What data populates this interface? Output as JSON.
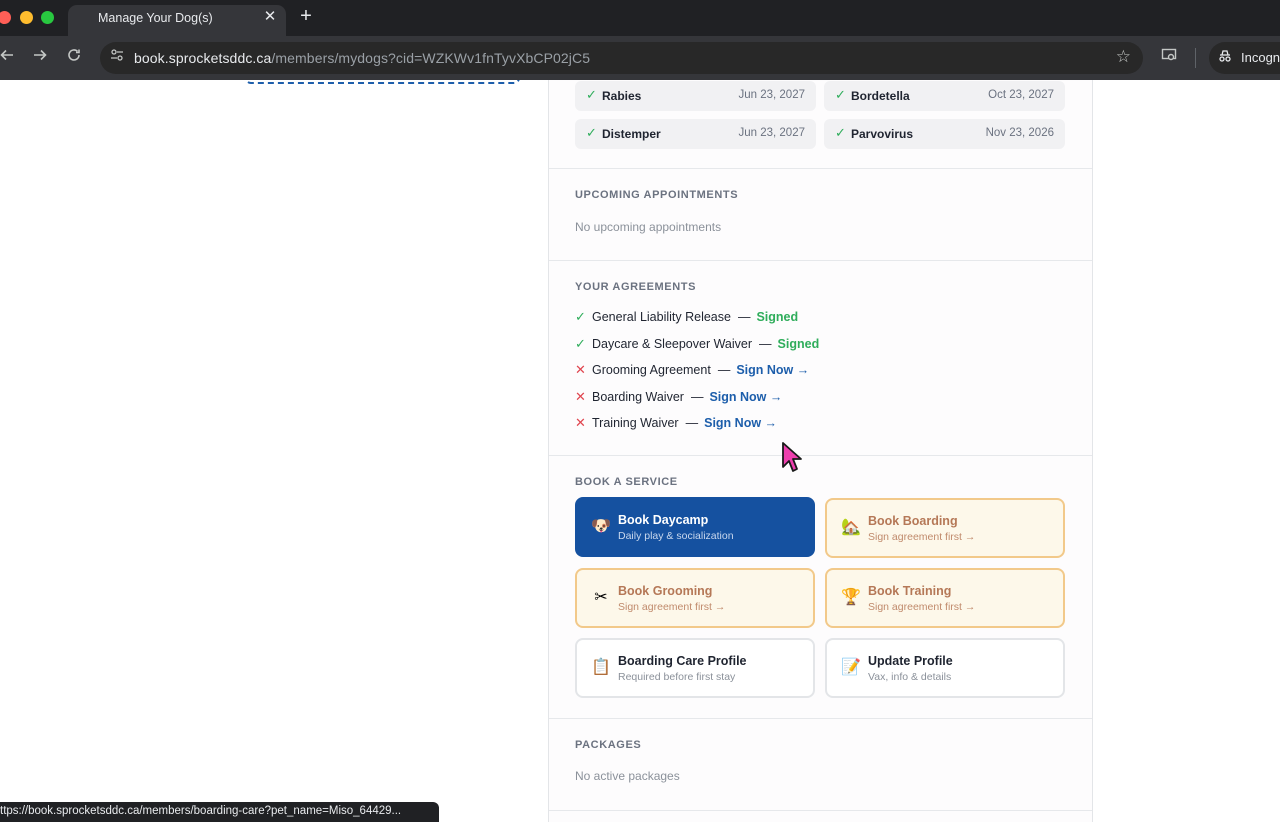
{
  "browser": {
    "tab_title": "Manage Your Dog(s)",
    "tab_close": "✕",
    "new_tab": "+",
    "url_host": "book.sprocketsddc.ca",
    "url_path": "/members/mydogs?cid=WZKWv1fnTyvXbCP02jC5",
    "profile_label": "Incogn",
    "status_url": "ttps://book.sprocketsddc.ca/members/boarding-care?pet_name=Miso_64429..."
  },
  "vaccines": [
    {
      "name": "Rabies",
      "date": "Jun 23, 2027"
    },
    {
      "name": "Bordetella",
      "date": "Oct 23, 2027"
    },
    {
      "name": "Distemper",
      "date": "Jun 23, 2027"
    },
    {
      "name": "Parvovirus",
      "date": "Nov 23, 2026"
    }
  ],
  "appointments": {
    "title": "UPCOMING APPOINTMENTS",
    "empty": "No upcoming appointments"
  },
  "agreements": {
    "title": "YOUR AGREEMENTS",
    "items": [
      {
        "name": "General Liability Release",
        "status": "Signed"
      },
      {
        "name": "Daycare & Sleepover Waiver",
        "status": "Signed"
      },
      {
        "name": "Grooming Agreement",
        "action": "Sign Now →"
      },
      {
        "name": "Boarding Waiver",
        "action": "Sign Now →"
      },
      {
        "name": "Training Waiver",
        "action": "Sign Now →"
      }
    ]
  },
  "services": {
    "title": "BOOK A SERVICE",
    "cards": [
      {
        "title": "Book Daycamp",
        "subtitle": "Daily play & socialization",
        "icon": "dog-face-icon"
      },
      {
        "title": "Book Boarding",
        "subtitle": "Sign agreement first →",
        "icon": "house-icon"
      },
      {
        "title": "Book Grooming",
        "subtitle": "Sign agreement first →",
        "icon": "scissors-icon"
      },
      {
        "title": "Book Training",
        "subtitle": "Sign agreement first →",
        "icon": "trophy-icon"
      },
      {
        "title": "Boarding Care Profile",
        "subtitle": "Required before first stay",
        "icon": "clipboard-icon"
      },
      {
        "title": "Update Profile",
        "subtitle": "Vax, info & details",
        "icon": "memo-icon"
      }
    ]
  },
  "packages": {
    "title": "PACKAGES",
    "empty": "No active packages"
  },
  "colors": {
    "primary": "#1551a0",
    "signed": "#2fad5b",
    "unsigned": "#e0454f",
    "link": "#1d5eab",
    "locked_border": "#f2c98a"
  }
}
